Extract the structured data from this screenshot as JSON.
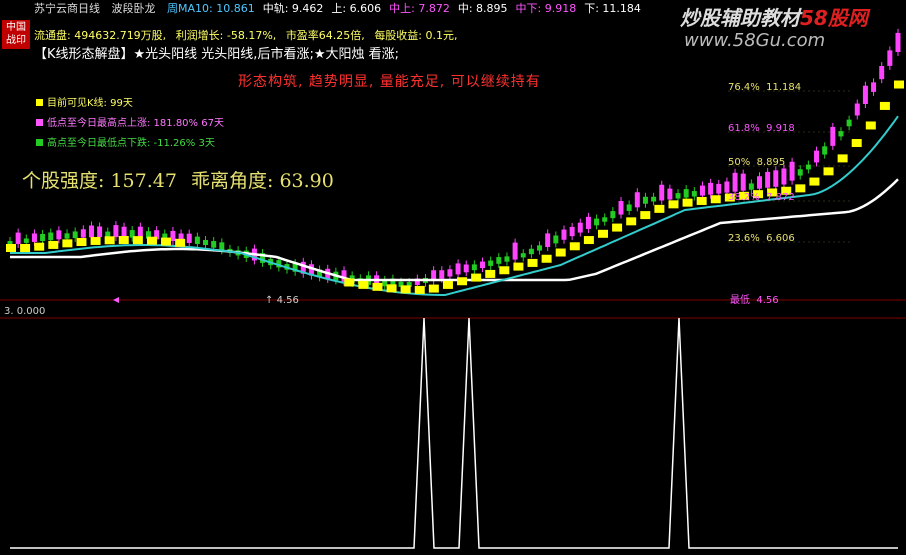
{
  "header": {
    "stock_name": "苏宁云商",
    "period": "日线",
    "indicator": "波段卧龙",
    "items": [
      {
        "label": "周MA10:",
        "value": "10.861",
        "color": "#4fc9ff"
      },
      {
        "label": "中轨:",
        "value": "9.462",
        "color": "#ffffff"
      },
      {
        "label": "上:",
        "value": "6.606",
        "color": "#ffffff"
      },
      {
        "label": "中上:",
        "value": "7.872",
        "color": "#ff55ff"
      },
      {
        "label": "中:",
        "value": "8.895",
        "color": "#ffffff"
      },
      {
        "label": "中下:",
        "value": "9.918",
        "color": "#ff55ff"
      },
      {
        "label": "下:",
        "value": "11.184",
        "color": "#ffffff"
      }
    ]
  },
  "badge": {
    "line1": "中国",
    "line2": "战印"
  },
  "info_line": {
    "float_shares": "流通盘: 494632.719万股,",
    "profit_growth": "利润增长: -58.17%,",
    "pe": "市盈率64.25倍,",
    "eps": "每股收益: 0.1元,"
  },
  "pattern_text": "【K线形态解盘】★光头阳线 光头阳线,后市看涨;★大阳烛 看涨;",
  "slogan": "形态构筑, 趋势明显, 量能充足, 可以继续持有",
  "legend": [
    {
      "text": "目前可见K线: 99天",
      "color": "#ffff00"
    },
    {
      "text": "低点至今日最高点上涨: 181.80% 67天",
      "color": "#ff55ff"
    },
    {
      "text": "高点至今日最低点下跌: -11.26% 3天",
      "color": "#22cc22"
    }
  ],
  "strength": {
    "label": "个股强度:",
    "value": "157.47",
    "angle_label": "乖离角度:",
    "angle_value": "63.90"
  },
  "fib_levels": [
    {
      "pct": "76.4%",
      "price": "11.184",
      "color": "#e6e070"
    },
    {
      "pct": "61.8%",
      "price": "9.918",
      "color": "#ff55ff"
    },
    {
      "pct": "50%",
      "price": "8.895",
      "color": "#e6e070"
    },
    {
      "pct": "38.2%",
      "price": "7.872",
      "color": "#ff55ff"
    },
    {
      "pct": "23.6%",
      "price": "6.606",
      "color": "#e6e070"
    }
  ],
  "lowest": {
    "label": "最低",
    "value": "4.56"
  },
  "low_marker": "4.56",
  "panel2": {
    "label": "3.",
    "value": "0.000"
  },
  "watermark": {
    "pre": "炒股辅助教材",
    "red": "58股网",
    "url": "www.58Gu.com"
  },
  "colors": {
    "up": "#ff44ff",
    "down": "#22cc22",
    "white_line": "#ffffff",
    "cyan_line": "#33cccc",
    "yellow_band": "#ffff00",
    "fib_line": "#e6e070"
  }
}
